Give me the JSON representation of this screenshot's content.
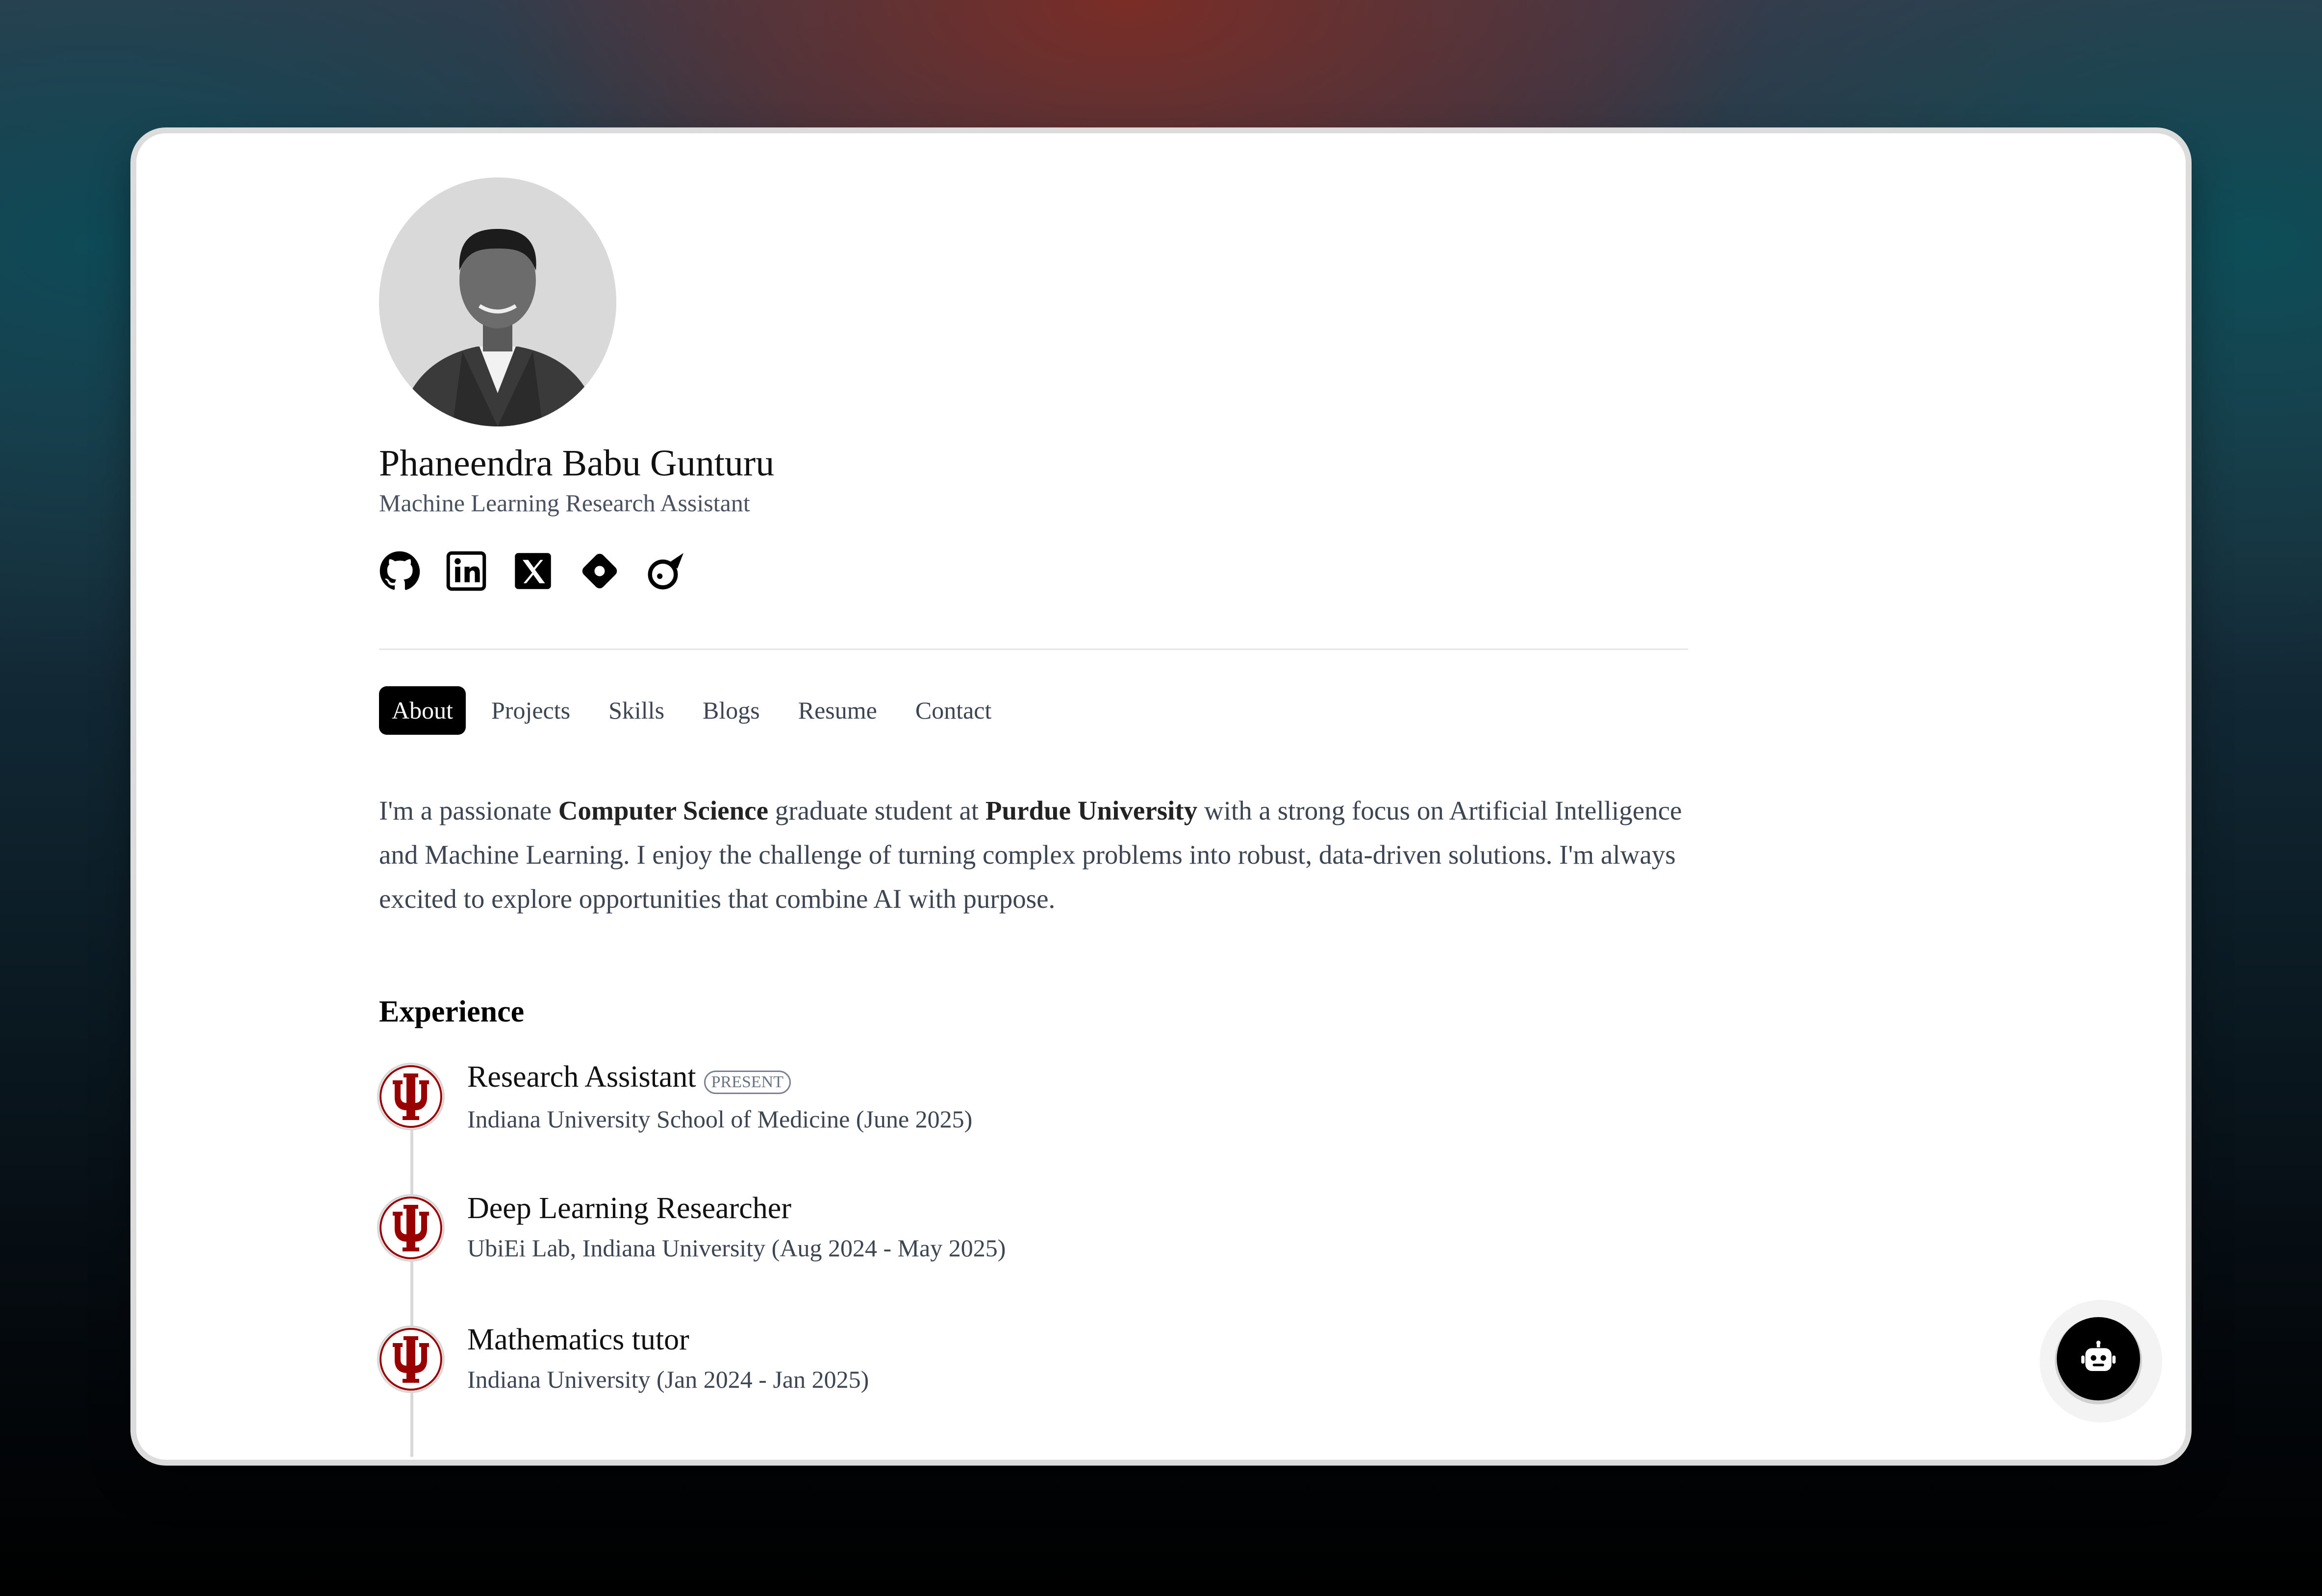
{
  "profile": {
    "name": "Phaneendra Babu Gunturu",
    "title": "Machine Learning Research Assistant"
  },
  "socials": [
    {
      "icon": "github-icon"
    },
    {
      "icon": "linkedin-icon"
    },
    {
      "icon": "x-twitter-icon"
    },
    {
      "icon": "diamond-icon"
    },
    {
      "icon": "rocket-icon"
    }
  ],
  "nav": {
    "tabs": [
      "About",
      "Projects",
      "Skills",
      "Blogs",
      "Resume",
      "Contact"
    ],
    "active": "About"
  },
  "about": {
    "part1": "I'm a passionate ",
    "highlight1": "Computer Science",
    "part2": " graduate student at ",
    "highlight2": "Purdue University",
    "part3": " with a strong focus on Artificial Intelligence and Machine Learning. I enjoy the challenge of turning complex problems into robust, data-driven solutions. I'm always excited to explore opportunities that combine AI with purpose."
  },
  "experience": {
    "heading": "Experience",
    "items": [
      {
        "title": "Research Assistant",
        "badge": "PRESENT",
        "org": "Indiana University School of Medicine (June 2025)"
      },
      {
        "title": "Deep Learning Researcher",
        "org": "UbiEi Lab, Indiana University (Aug 2024 - May 2025)"
      },
      {
        "title": "Mathematics tutor",
        "org": "Indiana University (Jan 2024 - Jan 2025)"
      }
    ]
  },
  "colors": {
    "accent": "#000000",
    "iu_crimson": "#990000",
    "muted_text": "#4a5160"
  }
}
